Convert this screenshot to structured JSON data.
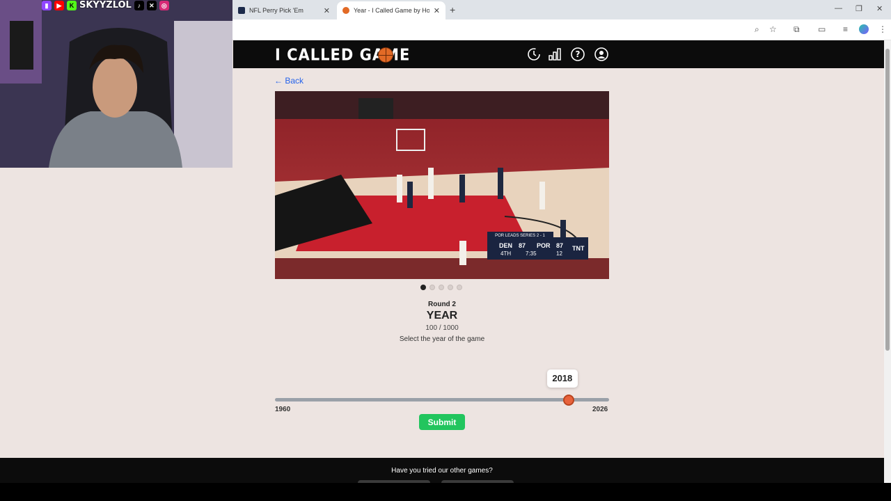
{
  "browser": {
    "tabs": [
      {
        "label": "NFL Perry Pick 'Em",
        "active": false
      },
      {
        "label": "Year - I Called Game by HoopGrids",
        "active": true
      }
    ]
  },
  "site": {
    "logo": "I CALLED GAME",
    "header_icons": [
      "history-icon",
      "stats-icon",
      "help-icon",
      "profile-icon"
    ]
  },
  "page": {
    "back_label": "← Back",
    "media_slides": 5,
    "active_slide": 1,
    "round_label": "Round 2",
    "title": "YEAR",
    "score": "100 / 1000",
    "instruction": "Select the year of the game"
  },
  "scoreboard": {
    "series": "POR LEADS SERIES 2 - 1",
    "away_team": "DEN",
    "away_score": "87",
    "home_team": "POR",
    "home_score": "87",
    "period": "4TH",
    "clock": "7:35",
    "shot_clock": "12",
    "network": "TNT"
  },
  "slider": {
    "min_label": "1960",
    "max_label": "2026",
    "min": 1960,
    "max": 2026,
    "value": 2018,
    "value_label": "2018"
  },
  "submit_label": "Submit",
  "footer": {
    "text": "Have you tried our other games?"
  },
  "overlay": {
    "handle": "SKYYZLOL"
  },
  "colors": {
    "accent_green": "#22c55e",
    "link_blue": "#2563eb",
    "page_bg": "#ede4e1",
    "header_bg": "#0c0c0c",
    "slider_thumb": "#e8623b"
  }
}
